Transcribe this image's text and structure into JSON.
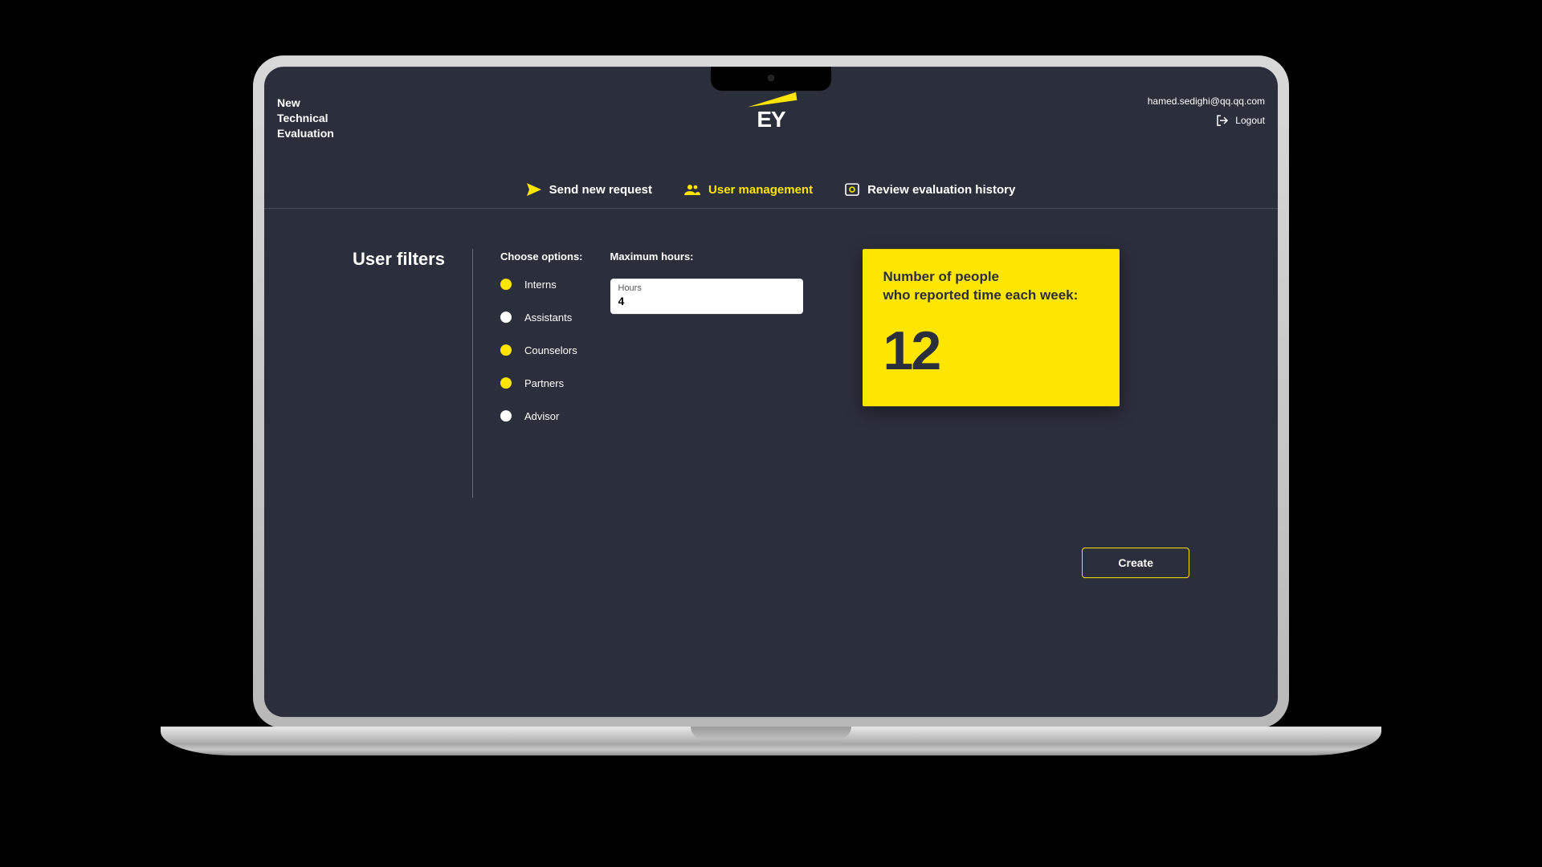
{
  "header": {
    "title_line1": "New",
    "title_line2": "Technical",
    "title_line3": "Evaluation",
    "logo_text": "EY",
    "user_email": "hamed.sedighi@qq.qq.com",
    "logout_label": "Logout"
  },
  "nav": {
    "send": "Send new request",
    "user_mgmt": "User management",
    "history": "Review evaluation history"
  },
  "filters": {
    "title": "User filters",
    "options_label": "Choose options:",
    "options": [
      {
        "label": "Interns",
        "selected": true
      },
      {
        "label": "Assistants",
        "selected": false
      },
      {
        "label": "Counselors",
        "selected": true
      },
      {
        "label": "Partners",
        "selected": true
      },
      {
        "label": "Advisor",
        "selected": false
      }
    ]
  },
  "hours": {
    "section_label": "Maximum hours:",
    "field_label": "Hours",
    "value": "4"
  },
  "stat": {
    "title_line1": "Number of people",
    "title_line2": "who reported time each week:",
    "value": "12"
  },
  "actions": {
    "create": "Create"
  },
  "colors": {
    "accent": "#ffe600",
    "bg": "#2b2e3b"
  }
}
